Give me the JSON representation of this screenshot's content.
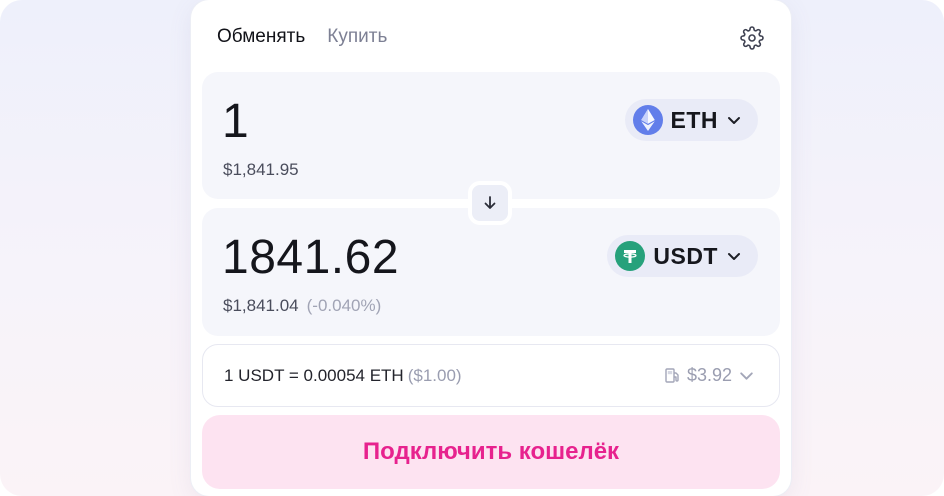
{
  "tabs": {
    "swap": "Обменять",
    "buy": "Купить"
  },
  "icons": {
    "settings": "gear-icon",
    "swap": "arrow-down-icon",
    "eth": "ethereum-icon",
    "usdt": "tether-icon",
    "gas": "gas-pump-icon",
    "chevron": "chevron-down-icon"
  },
  "sell": {
    "amount": "1",
    "usd_value": "$1,841.95",
    "token": "ETH"
  },
  "buy": {
    "amount": "1841.62",
    "usd_value": "$1,841.04",
    "price_impact": "(-0.040%)",
    "token": "USDT"
  },
  "rate": {
    "text": "1 USDT = 0.00054 ETH",
    "usd": "($1.00)",
    "gas_fee": "$3.92"
  },
  "connect_button": "Подключить кошелёк",
  "colors": {
    "accent": "#e7228e",
    "accent_bg": "#fde3f1",
    "eth": "#627eea",
    "usdt": "#26a17b",
    "panel": "#f5f6fb"
  }
}
